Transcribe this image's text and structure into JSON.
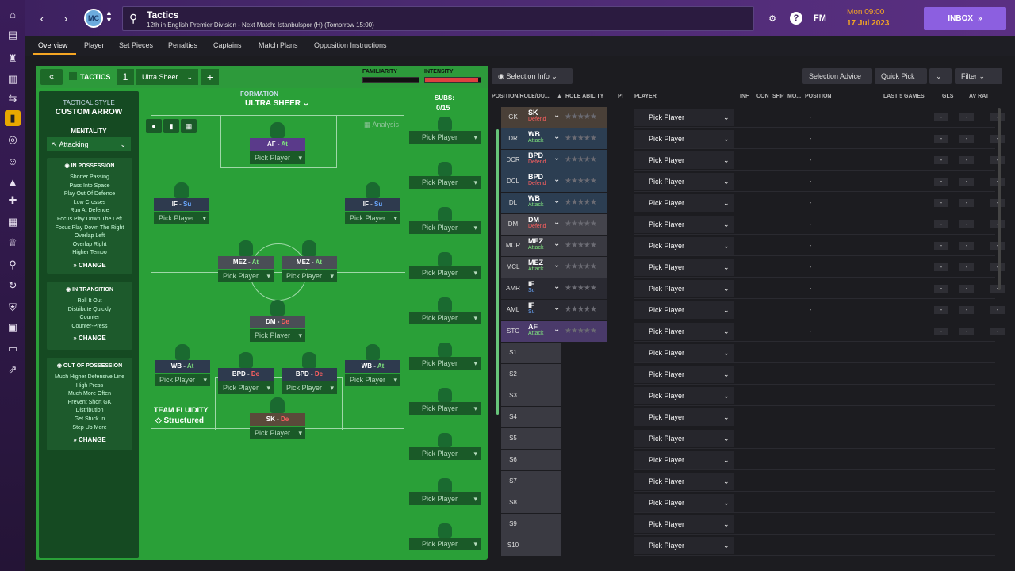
{
  "sidebar": {
    "icons": [
      "home-icon",
      "inbox-icon",
      "shirt-icon",
      "notes-icon",
      "transfer-icon",
      "tactics-icon",
      "globe-icon",
      "team-icon",
      "staff-icon",
      "medical-icon",
      "calendar-icon",
      "trophy-icon",
      "scouting-icon",
      "transfers-icon",
      "club-icon",
      "finance-icon",
      "dev-icon",
      "stats-icon"
    ]
  },
  "header": {
    "title": "Tactics",
    "subtitle": "12th in English Premier Division - Next Match: Istanbulspor (H) (Tomorrow 15:00)",
    "club_badge": "MC",
    "time": "Mon 09:00",
    "date": "17 Jul 2023",
    "inbox_label": "INBOX",
    "fm_logo": "FM"
  },
  "tabs": [
    "Overview",
    "Player",
    "Set Pieces",
    "Penalties",
    "Captains",
    "Match Plans",
    "Opposition Instructions"
  ],
  "tactic": {
    "label": "TACTICS",
    "number": "1",
    "name": "Ultra Sheer",
    "familiarity_label": "FAMILIARITY",
    "intensity_label": "INTENSITY",
    "familiarity": 0.0,
    "intensity": 0.95,
    "style_label": "TACTICAL STYLE",
    "style_value": "CUSTOM ARROW",
    "mentality_label": "MENTALITY",
    "mentality_value": "Attacking",
    "formation_label": "FORMATION",
    "formation_value": "ULTRA SHEER",
    "analysis": "Analysis",
    "fluidity_label": "TEAM FLUIDITY",
    "fluidity_value": "Structured",
    "subs_label": "SUBS:",
    "subs_count": "0/15",
    "change": "CHANGE"
  },
  "in_possession": {
    "title": "IN POSSESSION",
    "items": [
      "Shorter Passing",
      "Pass Into Space",
      "Play Out Of Defence",
      "Low Crosses",
      "Run At Defence",
      "Focus Play Down The Left",
      "Focus Play Down The Right",
      "Overlap Left",
      "Overlap Right",
      "Higher Tempo"
    ]
  },
  "in_transition": {
    "title": "IN TRANSITION",
    "items": [
      "Roll It Out",
      "Distribute Quickly",
      "Counter",
      "Counter-Press"
    ]
  },
  "out_possession": {
    "title": "OUT OF POSSESSION",
    "items": [
      "Much Higher Defensive Line",
      "High Press",
      "Much More Often",
      "Prevent Short GK",
      "Distribution",
      "Get Stuck In",
      "Step Up More"
    ]
  },
  "slots": [
    {
      "role": "AF",
      "duty": "At",
      "player": "Pick Player",
      "color": "#5a3a8a",
      "duty_color": "#7ee27e"
    },
    {
      "role": "IF",
      "duty": "Su",
      "player": "Pick Player",
      "color": "#2e3a4e",
      "duty_color": "#6aa8ff"
    },
    {
      "role": "IF",
      "duty": "Su",
      "player": "Pick Player",
      "color": "#2e3a4e",
      "duty_color": "#6aa8ff"
    },
    {
      "role": "MEZ",
      "duty": "At",
      "player": "Pick Player",
      "color": "#4a4e56",
      "duty_color": "#7ee27e"
    },
    {
      "role": "MEZ",
      "duty": "At",
      "player": "Pick Player",
      "color": "#4a4e56",
      "duty_color": "#7ee27e"
    },
    {
      "role": "DM",
      "duty": "De",
      "player": "Pick Player",
      "color": "#4a4e56",
      "duty_color": "#ff6060"
    },
    {
      "role": "WB",
      "duty": "At",
      "player": "Pick Player",
      "color": "#2e3a4e",
      "duty_color": "#7ee27e"
    },
    {
      "role": "BPD",
      "duty": "De",
      "player": "Pick Player",
      "color": "#2e3a4e",
      "duty_color": "#ff6060"
    },
    {
      "role": "BPD",
      "duty": "De",
      "player": "Pick Player",
      "color": "#2e3a4e",
      "duty_color": "#ff6060"
    },
    {
      "role": "WB",
      "duty": "At",
      "player": "Pick Player",
      "color": "#2e3a4e",
      "duty_color": "#7ee27e"
    },
    {
      "role": "SK",
      "duty": "De",
      "player": "Pick Player",
      "color": "#5a4a3a",
      "duty_color": "#ff6060"
    }
  ],
  "subs": [
    "Pick Player",
    "Pick Player",
    "Pick Player",
    "Pick Player",
    "Pick Player",
    "Pick Player",
    "Pick Player",
    "Pick Player",
    "Pick Player",
    "Pick Player"
  ],
  "toolbar": {
    "selection_info": "Selection Info",
    "selection_advice": "Selection Advice",
    "quick_pick": "Quick Pick",
    "filter": "Filter"
  },
  "columns": [
    "POSITION/ROLE/DU...",
    "ROLE ABILITY",
    "PI",
    "PLAYER",
    "INF",
    "CON",
    "SHP",
    "MO...",
    "POSITION",
    "LAST 5 GAMES",
    "GLS",
    "AV RAT"
  ],
  "rows": [
    {
      "pos": "GK",
      "role": "SK",
      "duty": "Defend",
      "player": "Pick Player",
      "bg": "#4a4038",
      "duty_color": "#ff6060"
    },
    {
      "pos": "DR",
      "role": "WB",
      "duty": "Attack",
      "player": "Pick Player",
      "bg": "#2c3e52",
      "duty_color": "#7ee27e"
    },
    {
      "pos": "DCR",
      "role": "BPD",
      "duty": "Defend",
      "player": "Pick Player",
      "bg": "#2c3e52",
      "duty_color": "#ff6060"
    },
    {
      "pos": "DCL",
      "role": "BPD",
      "duty": "Defend",
      "player": "Pick Player",
      "bg": "#2c3e52",
      "duty_color": "#ff6060"
    },
    {
      "pos": "DL",
      "role": "WB",
      "duty": "Attack",
      "player": "Pick Player",
      "bg": "#2c3e52",
      "duty_color": "#7ee27e"
    },
    {
      "pos": "DM",
      "role": "DM",
      "duty": "Defend",
      "player": "Pick Player",
      "bg": "#44444c",
      "duty_color": "#ff6060"
    },
    {
      "pos": "MCR",
      "role": "MEZ",
      "duty": "Attack",
      "player": "Pick Player",
      "bg": "#3a3a42",
      "duty_color": "#7ee27e"
    },
    {
      "pos": "MCL",
      "role": "MEZ",
      "duty": "Attack",
      "player": "Pick Player",
      "bg": "#3a3a42",
      "duty_color": "#7ee27e"
    },
    {
      "pos": "AMR",
      "role": "IF",
      "duty": "Su",
      "player": "Pick Player",
      "bg": "#2a2a32",
      "duty_color": "#6aa8ff"
    },
    {
      "pos": "AML",
      "role": "IF",
      "duty": "Su",
      "player": "Pick Player",
      "bg": "#2a2a32",
      "duty_color": "#6aa8ff"
    },
    {
      "pos": "STC",
      "role": "AF",
      "duty": "Attack",
      "player": "Pick Player",
      "bg": "#4a3a6a",
      "duty_color": "#7ee27e"
    },
    {
      "pos": "S1",
      "role": "",
      "duty": "",
      "player": "Pick Player",
      "bg": "#3a3a42",
      "duty_color": "#fff"
    },
    {
      "pos": "S2",
      "role": "",
      "duty": "",
      "player": "Pick Player",
      "bg": "#3a3a42",
      "duty_color": "#fff"
    },
    {
      "pos": "S3",
      "role": "",
      "duty": "",
      "player": "Pick Player",
      "bg": "#3a3a42",
      "duty_color": "#fff"
    },
    {
      "pos": "S4",
      "role": "",
      "duty": "",
      "player": "Pick Player",
      "bg": "#3a3a42",
      "duty_color": "#fff"
    },
    {
      "pos": "S5",
      "role": "",
      "duty": "",
      "player": "Pick Player",
      "bg": "#3a3a42",
      "duty_color": "#fff"
    },
    {
      "pos": "S6",
      "role": "",
      "duty": "",
      "player": "Pick Player",
      "bg": "#3a3a42",
      "duty_color": "#fff"
    },
    {
      "pos": "S7",
      "role": "",
      "duty": "",
      "player": "Pick Player",
      "bg": "#3a3a42",
      "duty_color": "#fff"
    },
    {
      "pos": "S8",
      "role": "",
      "duty": "",
      "player": "Pick Player",
      "bg": "#3a3a42",
      "duty_color": "#fff"
    },
    {
      "pos": "S9",
      "role": "",
      "duty": "",
      "player": "Pick Player",
      "bg": "#3a3a42",
      "duty_color": "#fff"
    },
    {
      "pos": "S10",
      "role": "",
      "duty": "",
      "player": "Pick Player",
      "bg": "#3a3a42",
      "duty_color": "#fff"
    }
  ],
  "dash": "-"
}
